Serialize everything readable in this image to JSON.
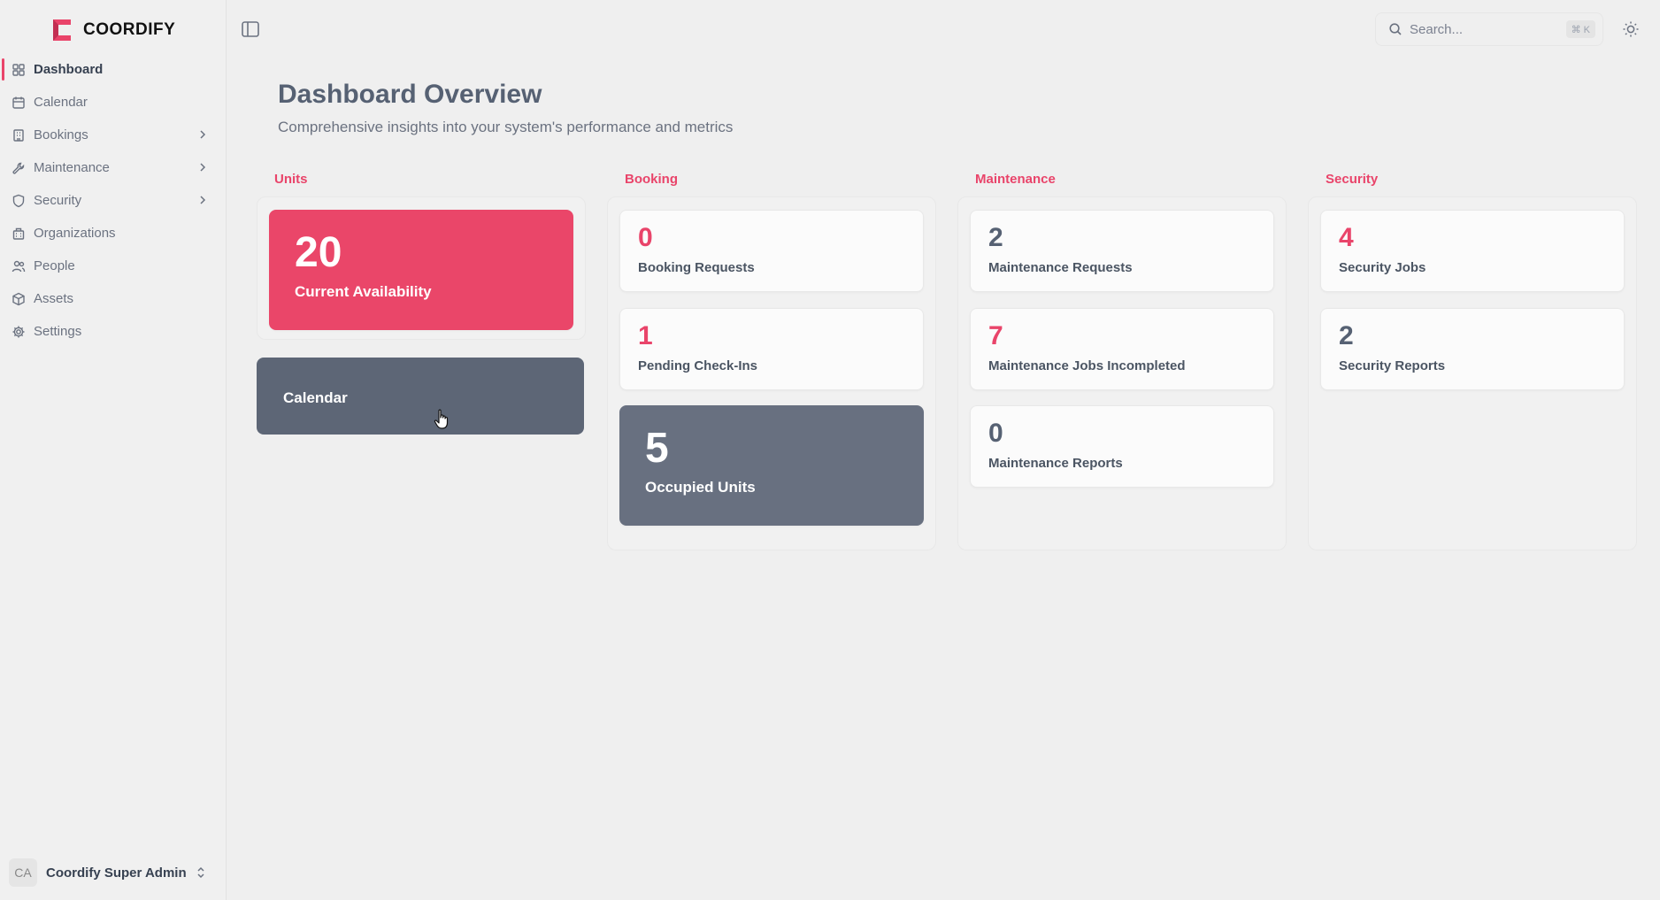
{
  "brand": {
    "name": "COORDIFY"
  },
  "nav": [
    {
      "label": "Dashboard",
      "icon": "grid-icon",
      "active": true
    },
    {
      "label": "Calendar",
      "icon": "calendar-icon"
    },
    {
      "label": "Bookings",
      "icon": "building-icon",
      "has_submenu": true
    },
    {
      "label": "Maintenance",
      "icon": "wrench-icon",
      "has_submenu": true
    },
    {
      "label": "Security",
      "icon": "shield-icon",
      "has_submenu": true
    },
    {
      "label": "Organizations",
      "icon": "organization-icon"
    },
    {
      "label": "People",
      "icon": "people-icon"
    },
    {
      "label": "Assets",
      "icon": "box-icon"
    },
    {
      "label": "Settings",
      "icon": "gear-icon"
    }
  ],
  "user": {
    "initials": "CA",
    "name": "Coordify Super Admin"
  },
  "search": {
    "placeholder": "Search...",
    "shortcut": "⌘ K"
  },
  "header": {
    "title": "Dashboard Overview",
    "subtitle": "Comprehensive insights into your system's performance and metrics"
  },
  "columns": {
    "units": {
      "label": "Units",
      "availability": {
        "value": "20",
        "label": "Current Availability"
      },
      "calendar_label": "Calendar"
    },
    "booking": {
      "label": "Booking",
      "cards": [
        {
          "value": "0",
          "label": "Booking Requests"
        },
        {
          "value": "1",
          "label": "Pending Check-Ins"
        }
      ],
      "occupied": {
        "value": "5",
        "label": "Occupied Units"
      }
    },
    "maintenance": {
      "label": "Maintenance",
      "cards": [
        {
          "value": "2",
          "label": "Maintenance Requests"
        },
        {
          "value": "7",
          "label": "Maintenance Jobs Incompleted"
        },
        {
          "value": "0",
          "label": "Maintenance Reports"
        }
      ]
    },
    "security": {
      "label": "Security",
      "cards": [
        {
          "value": "4",
          "label": "Security Jobs"
        },
        {
          "value": "2",
          "label": "Security Reports"
        }
      ]
    }
  },
  "colors": {
    "accent": "#e9446a",
    "slate": "#5d6676",
    "background": "#efefef"
  }
}
